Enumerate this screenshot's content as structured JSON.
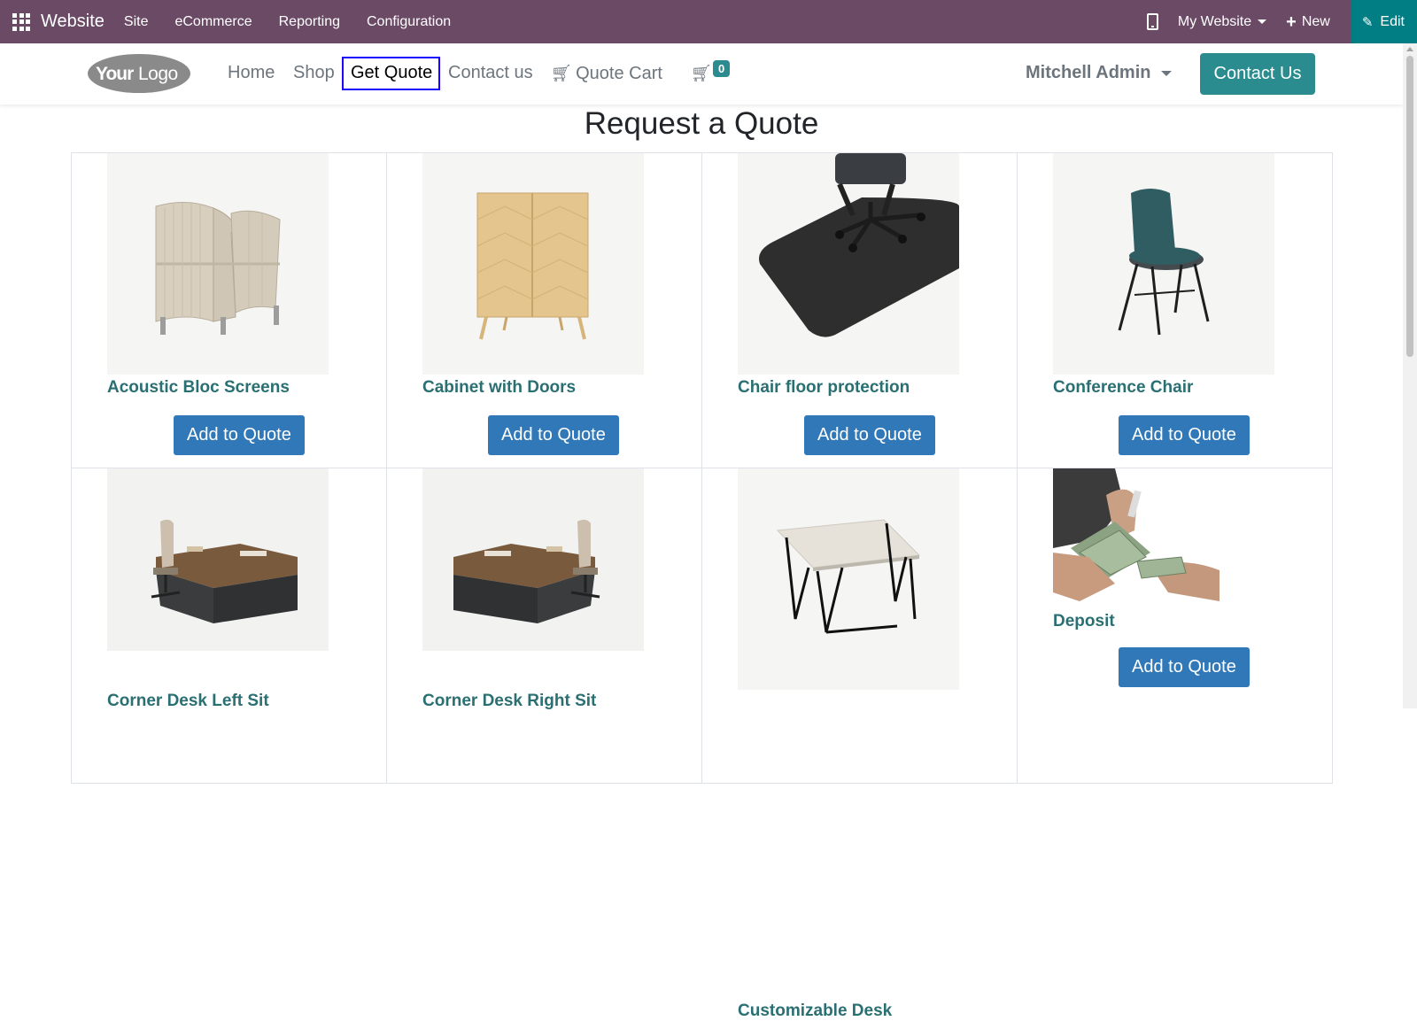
{
  "admin_bar": {
    "app_name": "Website",
    "menus": [
      "Site",
      "eCommerce",
      "Reporting",
      "Configuration"
    ],
    "website_selector": "My Website",
    "new_label": "New",
    "edit_label": "Edit",
    "icons": [
      "apps-grid-icon",
      "mobile-phone-icon",
      "plus-icon",
      "pencil-icon"
    ],
    "colors": {
      "bar": "#6b4a66",
      "edit": "#017e84"
    }
  },
  "header": {
    "logo_text": "YourLogo",
    "nav": [
      "Home",
      "Shop",
      "Get Quote",
      "Contact us",
      "Quote Cart"
    ],
    "active_nav": "Get Quote",
    "cart_count": "0",
    "user": "Mitchell Admin",
    "cta": "Contact Us",
    "colors": {
      "accent": "#2a8c8e"
    }
  },
  "page": {
    "title": "Request a Quote",
    "add_button_label": "Add to Quote",
    "products": [
      {
        "name": "Acoustic Bloc Screens",
        "image": "acoustic-screen-image"
      },
      {
        "name": "Cabinet with Doors",
        "image": "cabinet-image"
      },
      {
        "name": "Chair floor protection",
        "image": "floor-mat-image"
      },
      {
        "name": "Conference Chair",
        "image": "conference-chair-image"
      },
      {
        "name": "Corner Desk Left Sit",
        "image": "corner-desk-left-image"
      },
      {
        "name": "Corner Desk Right Sit",
        "image": "corner-desk-right-image"
      },
      {
        "name": "Customizable Desk",
        "image": "customizable-desk-image"
      },
      {
        "name": "Deposit",
        "image": "deposit-money-image"
      }
    ],
    "colors": {
      "product_name": "#2a6f72",
      "button": "#3178b8"
    }
  }
}
